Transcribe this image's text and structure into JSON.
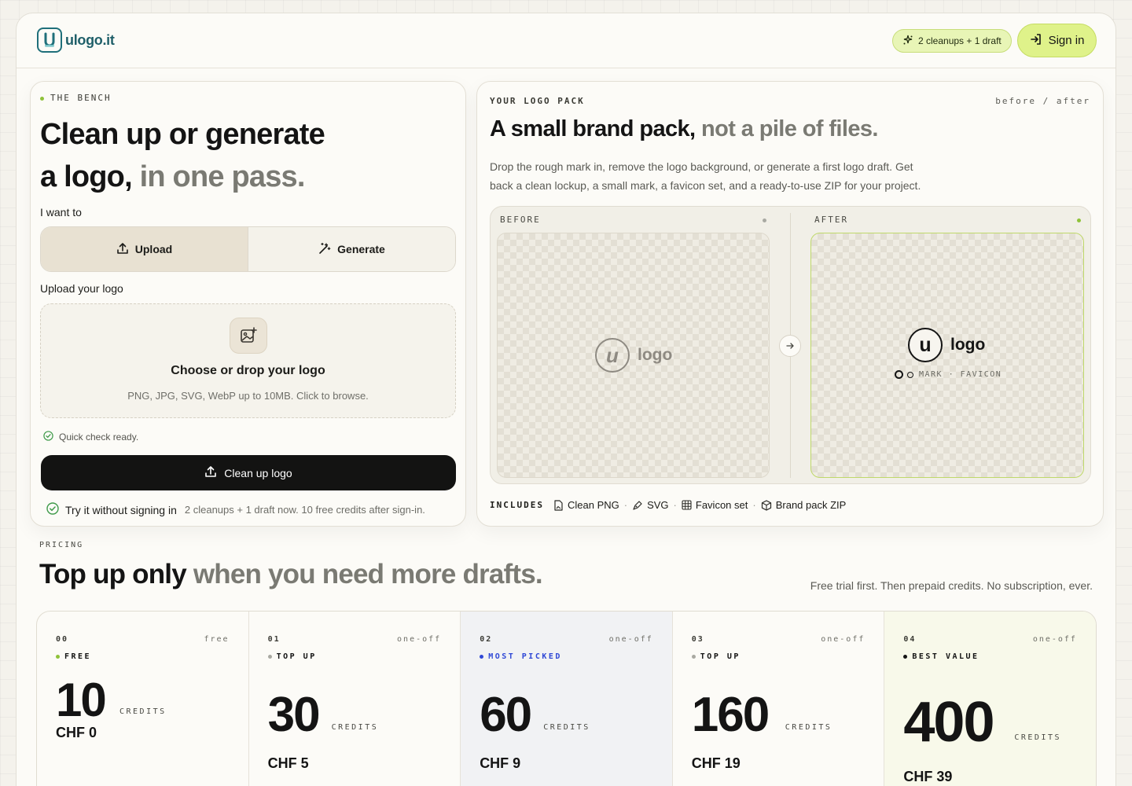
{
  "brand": {
    "name": "ulogo.it",
    "letter": "u"
  },
  "header": {
    "credit_pill": "2 cleanups + 1 draft",
    "signin": "Sign in"
  },
  "bench": {
    "eyebrow": "THE BENCH",
    "title_line1": "Clean up or generate",
    "title_line2_strong": "a logo,",
    "title_line2_muted": " in one pass.",
    "intent_label": "I want to",
    "mode_upload": "Upload",
    "mode_generate": "Generate",
    "upload_label": "Upload your logo",
    "dropzone_title": "Choose or drop your logo",
    "dropzone_sub": "PNG, JPG, SVG, WebP up to 10MB. Click to browse.",
    "quick_check": "Quick check ready.",
    "cta": "Clean up logo",
    "trial_strong": "Try it without signing in",
    "trial_dim": "2 cleanups + 1 draft now. 10 free credits after sign-in."
  },
  "pack": {
    "eyebrow": "YOUR LOGO PACK",
    "eyebrow_right": "before / after",
    "title_strong": "A small brand pack,",
    "title_muted": " not a pile of files.",
    "description": "Drop the rough mark in, remove the logo background, or generate a first logo draft. Get back a clean lockup, a small mark, a favicon set, and a ready-to-use ZIP for your project.",
    "before_label": "BEFORE",
    "after_label": "AFTER",
    "before_mark": "u",
    "before_word": "logo",
    "after_mark": "u",
    "after_word": "logo",
    "after_caption": "MARK · FAVICON",
    "includes_label": "INCLUDES",
    "includes": [
      "Clean PNG",
      "SVG",
      "Favicon set",
      "Brand pack ZIP"
    ]
  },
  "pricing": {
    "eyebrow": "PRICING",
    "title_strong": "Top up only",
    "title_muted": " when you need more drafts.",
    "note": "Free trial first. Then prepaid credits. No subscription, ever.",
    "plans": [
      {
        "num": "00",
        "kind": "free",
        "tag": "FREE",
        "credits": "10",
        "unit": "CREDITS",
        "price": "CHF 0",
        "dot": "#8fc23a"
      },
      {
        "num": "01",
        "kind": "one-off",
        "tag": "TOP UP",
        "credits": "30",
        "unit": "CREDITS",
        "price": "CHF 5",
        "dot": "#a9a9a2"
      },
      {
        "num": "02",
        "kind": "one-off",
        "tag": "MOST PICKED",
        "credits": "60",
        "unit": "CREDITS",
        "price": "CHF 9",
        "dot": "#2f48d6"
      },
      {
        "num": "03",
        "kind": "one-off",
        "tag": "TOP UP",
        "credits": "160",
        "unit": "CREDITS",
        "price": "CHF 19",
        "dot": "#a9a9a2"
      },
      {
        "num": "04",
        "kind": "one-off",
        "tag": "BEST VALUE",
        "credits": "400",
        "unit": "CREDITS",
        "price": "CHF 39",
        "dot": "#141414"
      }
    ]
  },
  "colors": {
    "accent_lime": "#dff28a",
    "brand_teal": "#1f6f7a",
    "popular_blue": "#2f48d6"
  }
}
